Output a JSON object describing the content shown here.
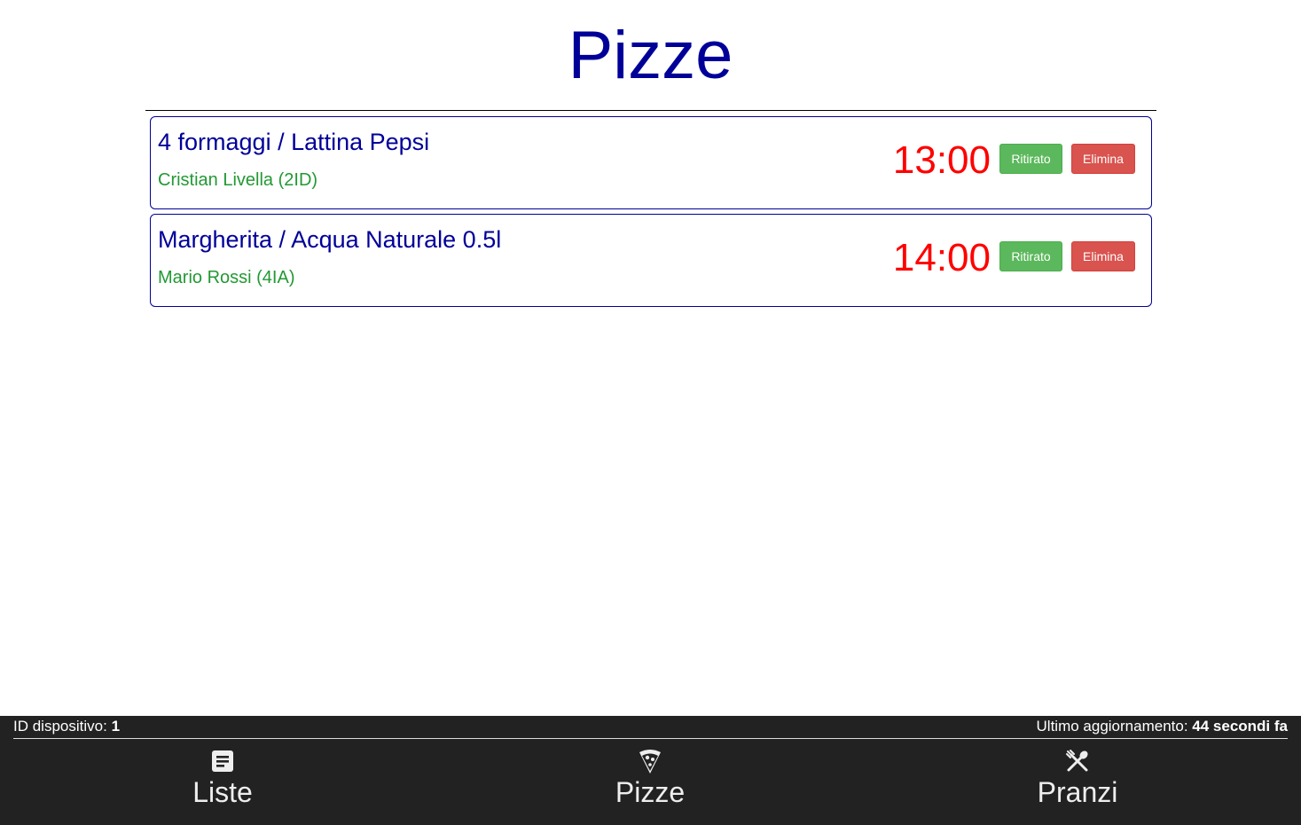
{
  "page": {
    "title": "Pizze"
  },
  "orders": [
    {
      "item": "4 formaggi / Lattina Pepsi",
      "customer": "Cristian Livella (2ID)",
      "time": "13:00",
      "picked_up_label": "Ritirato",
      "delete_label": "Elimina"
    },
    {
      "item": "Margherita / Acqua Naturale 0.5l",
      "customer": "Mario Rossi (4IA)",
      "time": "14:00",
      "picked_up_label": "Ritirato",
      "delete_label": "Elimina"
    }
  ],
  "status": {
    "device_id_label": "ID dispositivo:",
    "device_id_value": "1",
    "last_update_label": "Ultimo aggiornamento:",
    "last_update_value": "44 secondi fa"
  },
  "nav": {
    "items": [
      {
        "label": "Liste",
        "icon": "list-icon"
      },
      {
        "label": "Pizze",
        "icon": "pizza-icon"
      },
      {
        "label": "Pranzi",
        "icon": "utensils-icon"
      }
    ]
  },
  "colors": {
    "title": "#000099",
    "customer": "#229933",
    "time": "#ff0000",
    "ritirato_button": "#5cb85c",
    "elimina_button": "#d9534f",
    "footer_background": "#222222"
  }
}
